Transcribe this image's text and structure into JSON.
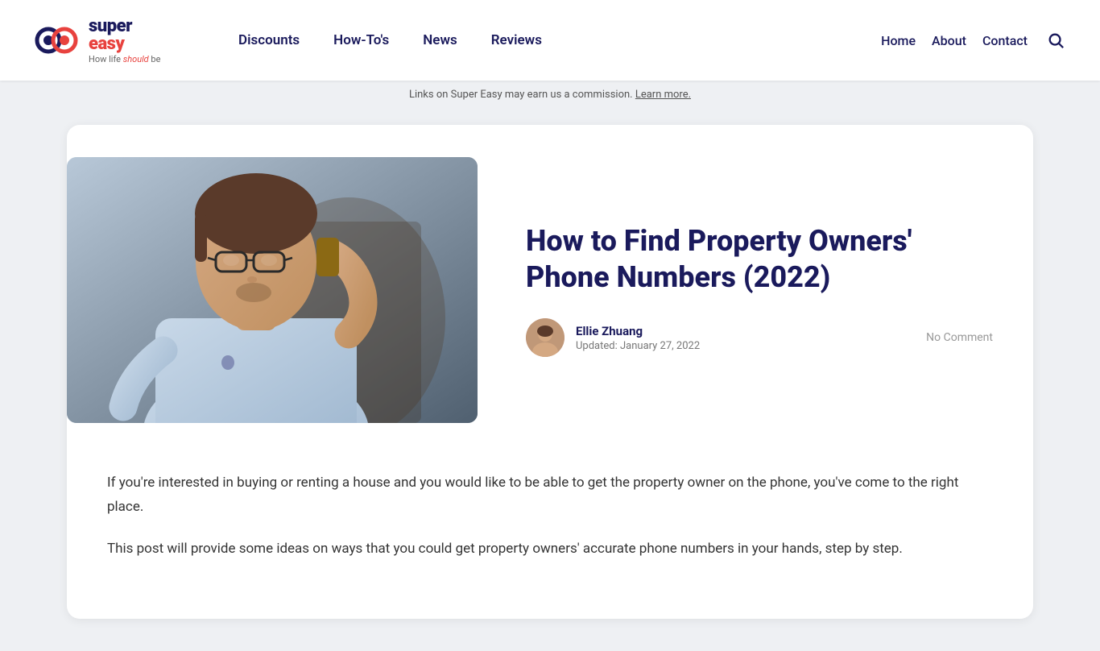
{
  "header": {
    "logo": {
      "super": "super",
      "easy": "easy",
      "tagline_prefix": "How life ",
      "tagline_em": "should",
      "tagline_suffix": " be"
    },
    "nav_main": [
      {
        "label": "Discounts",
        "href": "#"
      },
      {
        "label": "How-To's",
        "href": "#"
      },
      {
        "label": "News",
        "href": "#"
      },
      {
        "label": "Reviews",
        "href": "#"
      }
    ],
    "nav_right": [
      {
        "label": "Home",
        "href": "#"
      },
      {
        "label": "About",
        "href": "#"
      },
      {
        "label": "Contact",
        "href": "#"
      }
    ]
  },
  "commission_bar": {
    "text": "Links on Super Easy may earn us a commission.",
    "learn_more": "Learn more."
  },
  "article": {
    "title": "How to Find Property Owners' Phone Numbers (2022)",
    "author": {
      "name": "Ellie Zhuang",
      "updated": "Updated: January 27, 2022"
    },
    "no_comment": "No Comment",
    "body_p1": "If you're interested in buying or renting a house and you would like to be able to get the property owner on the phone, you've come to the right place.",
    "body_p2": "This post will provide some ideas on ways that you could get property owners' accurate phone numbers in your hands, step by step."
  }
}
